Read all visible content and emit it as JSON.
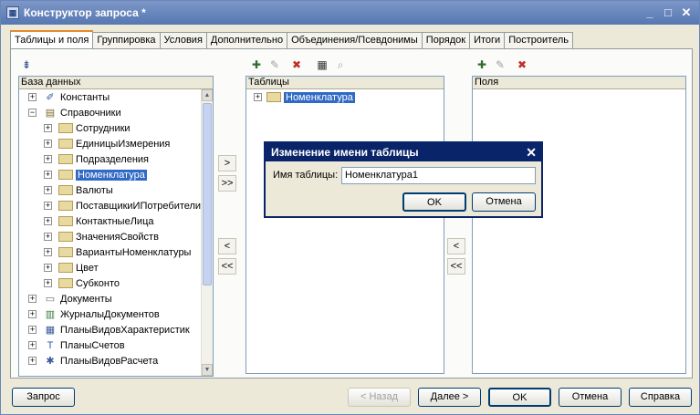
{
  "window": {
    "title": "Конструктор запроса *",
    "minimize_glyph": "_",
    "maximize_glyph": "□",
    "close_glyph": "✕"
  },
  "tabs": [
    "Таблицы и поля",
    "Группировка",
    "Условия",
    "Дополнительно",
    "Объединения/Псевдонимы",
    "Порядок",
    "Итоги",
    "Построитель"
  ],
  "db_panel": {
    "header": "База данных",
    "items": [
      {
        "label": "Константы",
        "level": 0,
        "expander": "+",
        "icon": "constants-icon"
      },
      {
        "label": "Справочники",
        "level": 0,
        "expander": "−",
        "icon": "catalogs-icon"
      },
      {
        "label": "Сотрудники",
        "level": 1,
        "expander": "+",
        "icon": "folder-icon"
      },
      {
        "label": "ЕдиницыИзмерения",
        "level": 1,
        "expander": "+",
        "icon": "folder-icon"
      },
      {
        "label": "Подразделения",
        "level": 1,
        "expander": "+",
        "icon": "folder-icon"
      },
      {
        "label": "Номенклатура",
        "level": 1,
        "expander": "+",
        "icon": "folder-icon",
        "selected": true
      },
      {
        "label": "Валюты",
        "level": 1,
        "expander": "+",
        "icon": "folder-icon"
      },
      {
        "label": "ПоставщикиИПотребители",
        "level": 1,
        "expander": "+",
        "icon": "folder-icon"
      },
      {
        "label": "КонтактныеЛица",
        "level": 1,
        "expander": "+",
        "icon": "folder-icon"
      },
      {
        "label": "ЗначенияСвойств",
        "level": 1,
        "expander": "+",
        "icon": "folder-icon"
      },
      {
        "label": "ВариантыНоменклатуры",
        "level": 1,
        "expander": "+",
        "icon": "folder-icon"
      },
      {
        "label": "Цвет",
        "level": 1,
        "expander": "+",
        "icon": "folder-icon"
      },
      {
        "label": "Субконто",
        "level": 1,
        "expander": "+",
        "icon": "folder-icon"
      },
      {
        "label": "Документы",
        "level": 0,
        "expander": "+",
        "icon": "documents-icon"
      },
      {
        "label": "ЖурналыДокументов",
        "level": 0,
        "expander": "+",
        "icon": "journals-icon"
      },
      {
        "label": "ПланыВидовХарактеристик",
        "level": 0,
        "expander": "+",
        "icon": "chart-types-icon"
      },
      {
        "label": "ПланыСчетов",
        "level": 0,
        "expander": "+",
        "icon": "accounts-icon"
      },
      {
        "label": "ПланыВидовРасчета",
        "level": 0,
        "expander": "+",
        "icon": "calc-types-icon"
      }
    ]
  },
  "tables_panel": {
    "header": "Таблицы",
    "items": [
      {
        "label": "Номенклатура",
        "expander": "+"
      }
    ]
  },
  "fields_panel": {
    "header": "Поля"
  },
  "arrows": {
    "add": ">",
    "add_all": ">>",
    "remove": "<",
    "remove_all": "<<"
  },
  "dialog": {
    "title": "Изменение имени таблицы",
    "label": "Имя таблицы:",
    "value": "Номенклатура1",
    "ok": "OK",
    "cancel": "Отмена",
    "close_glyph": "✕"
  },
  "footer": {
    "query": "Запрос",
    "back": "< Назад",
    "next": "Далее >",
    "ok": "OK",
    "cancel": "Отмена",
    "help": "Справка"
  }
}
